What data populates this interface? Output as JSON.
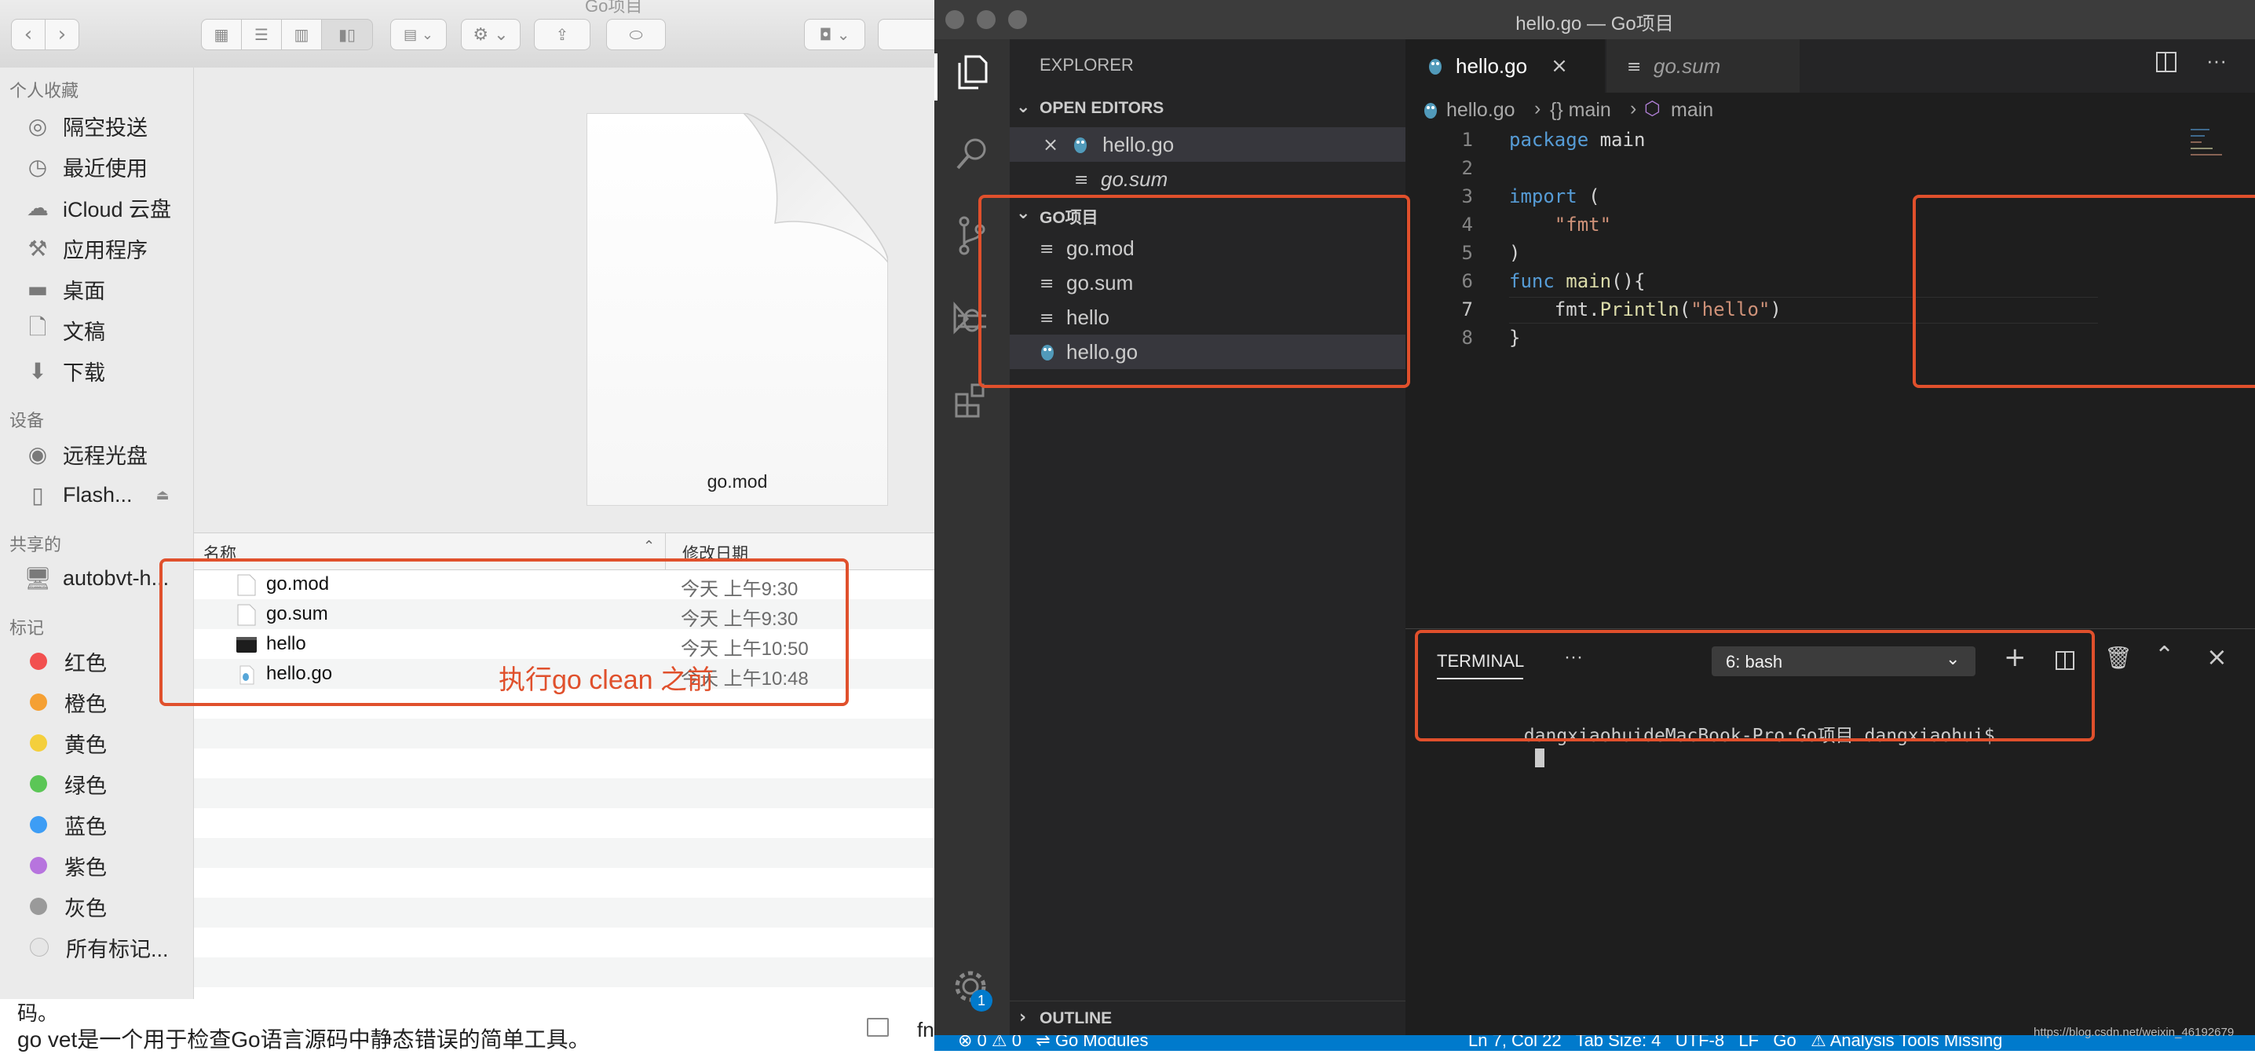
{
  "finder": {
    "title_tab": "Go项目",
    "sidebar": {
      "favorites_header": "个人收藏",
      "favorites": [
        {
          "label": "隔空投送",
          "icon": "airdrop-icon"
        },
        {
          "label": "最近使用",
          "icon": "clock-icon"
        },
        {
          "label": "iCloud 云盘",
          "icon": "cloud-icon"
        },
        {
          "label": "应用程序",
          "icon": "applications-icon"
        },
        {
          "label": "桌面",
          "icon": "desktop-icon"
        },
        {
          "label": "文稿",
          "icon": "document-icon"
        },
        {
          "label": "下载",
          "icon": "download-icon"
        }
      ],
      "devices_header": "设备",
      "devices": [
        {
          "label": "远程光盘",
          "icon": "disc-icon"
        },
        {
          "label": "Flash...",
          "icon": "drive-icon"
        }
      ],
      "shared_header": "共享的",
      "shared": [
        {
          "label": "autobvt-h...",
          "icon": "computer-icon"
        }
      ],
      "tags_header": "标记",
      "tags": [
        {
          "label": "红色",
          "color": "#f2504f"
        },
        {
          "label": "橙色",
          "color": "#f5a033"
        },
        {
          "label": "黄色",
          "color": "#f4cf3c"
        },
        {
          "label": "绿色",
          "color": "#5bc656"
        },
        {
          "label": "蓝色",
          "color": "#3d9df5"
        },
        {
          "label": "紫色",
          "color": "#b774de"
        },
        {
          "label": "灰色",
          "color": "#9a9a9a"
        },
        {
          "label": "所有标记...",
          "color": "#e6e6e6"
        }
      ]
    },
    "preview_label": "go.mod",
    "columns": {
      "name": "名称",
      "modified": "修改日期"
    },
    "files": [
      {
        "name": "go.mod",
        "modified": "今天 上午9:30",
        "icon": "text-file-icon"
      },
      {
        "name": "go.sum",
        "modified": "今天 上午9:30",
        "icon": "text-file-icon"
      },
      {
        "name": "hello",
        "modified": "今天 上午10:50",
        "icon": "executable-icon"
      },
      {
        "name": "hello.go",
        "modified": "今天 上午10:48",
        "icon": "go-file-icon"
      }
    ],
    "annotation": "执行go clean 之前",
    "accent": "#e0502c"
  },
  "page_below": {
    "line1": "码。",
    "line2": "go vet是一个用于检查Go语言源码中静态错误的简单工具。",
    "side_text": "fn"
  },
  "vscode": {
    "window_title": "hello.go — Go项目",
    "explorer_title": "EXPLORER",
    "open_editors_title": "OPEN EDITORS",
    "open_editors": [
      {
        "name": "hello.go",
        "italic": false
      },
      {
        "name": "go.sum",
        "italic": true
      }
    ],
    "folder_title": "GO项目",
    "folder_files": [
      {
        "name": "go.mod",
        "icon": "lines-file-icon"
      },
      {
        "name": "go.sum",
        "icon": "lines-file-icon"
      },
      {
        "name": "hello",
        "icon": "lines-file-icon"
      },
      {
        "name": "hello.go",
        "icon": "go-file-icon"
      }
    ],
    "outline_title": "OUTLINE",
    "badge_count": "1",
    "tabs": [
      {
        "name": "hello.go",
        "active": true
      },
      {
        "name": "go.sum",
        "active": false
      }
    ],
    "breadcrumb": {
      "file": "hello.go",
      "scope1": "{} main",
      "scope2": "main"
    },
    "code_lines": [
      "1",
      "2",
      "3",
      "4",
      "5",
      "6",
      "7",
      "8"
    ],
    "terminal": {
      "tab_label": "TERMINAL",
      "more": "···",
      "selector": "6: bash",
      "prompt": "dangxiaohuideMacBook-Pro:Go项目 dangxiaohui$"
    },
    "status": {
      "left": "⊗ 0 ⚠ 0   ⇌ Go Modules",
      "right": "Ln 7, Col 22   Tab Size: 4   UTF-8   LF   Go   ⚠ Analysis Tools Missing",
      "watermark": "https://blog.csdn.net/weixin_46192679"
    },
    "accent": "#007acc"
  }
}
